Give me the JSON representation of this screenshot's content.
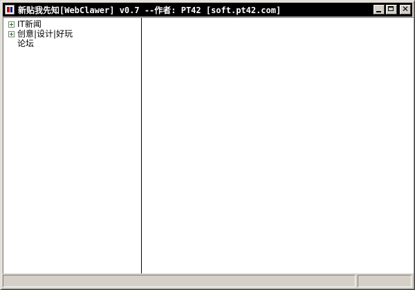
{
  "window": {
    "title": "新贴我先知[WebClawer] v0.7 --作者: PT42 [soft.pt42.com]",
    "icon": "app-icon"
  },
  "title_buttons": {
    "minimize_icon": "minimize-icon",
    "maximize_icon": "maximize-icon",
    "close_glyph": "✕"
  },
  "tree": {
    "items": [
      {
        "label": "IT新闻",
        "expandable": true
      },
      {
        "label": "创意|设计|好玩",
        "expandable": true
      },
      {
        "label": "论坛",
        "expandable": false
      }
    ]
  },
  "content": {},
  "statusbar": {
    "main_text": "",
    "side_text": ""
  }
}
